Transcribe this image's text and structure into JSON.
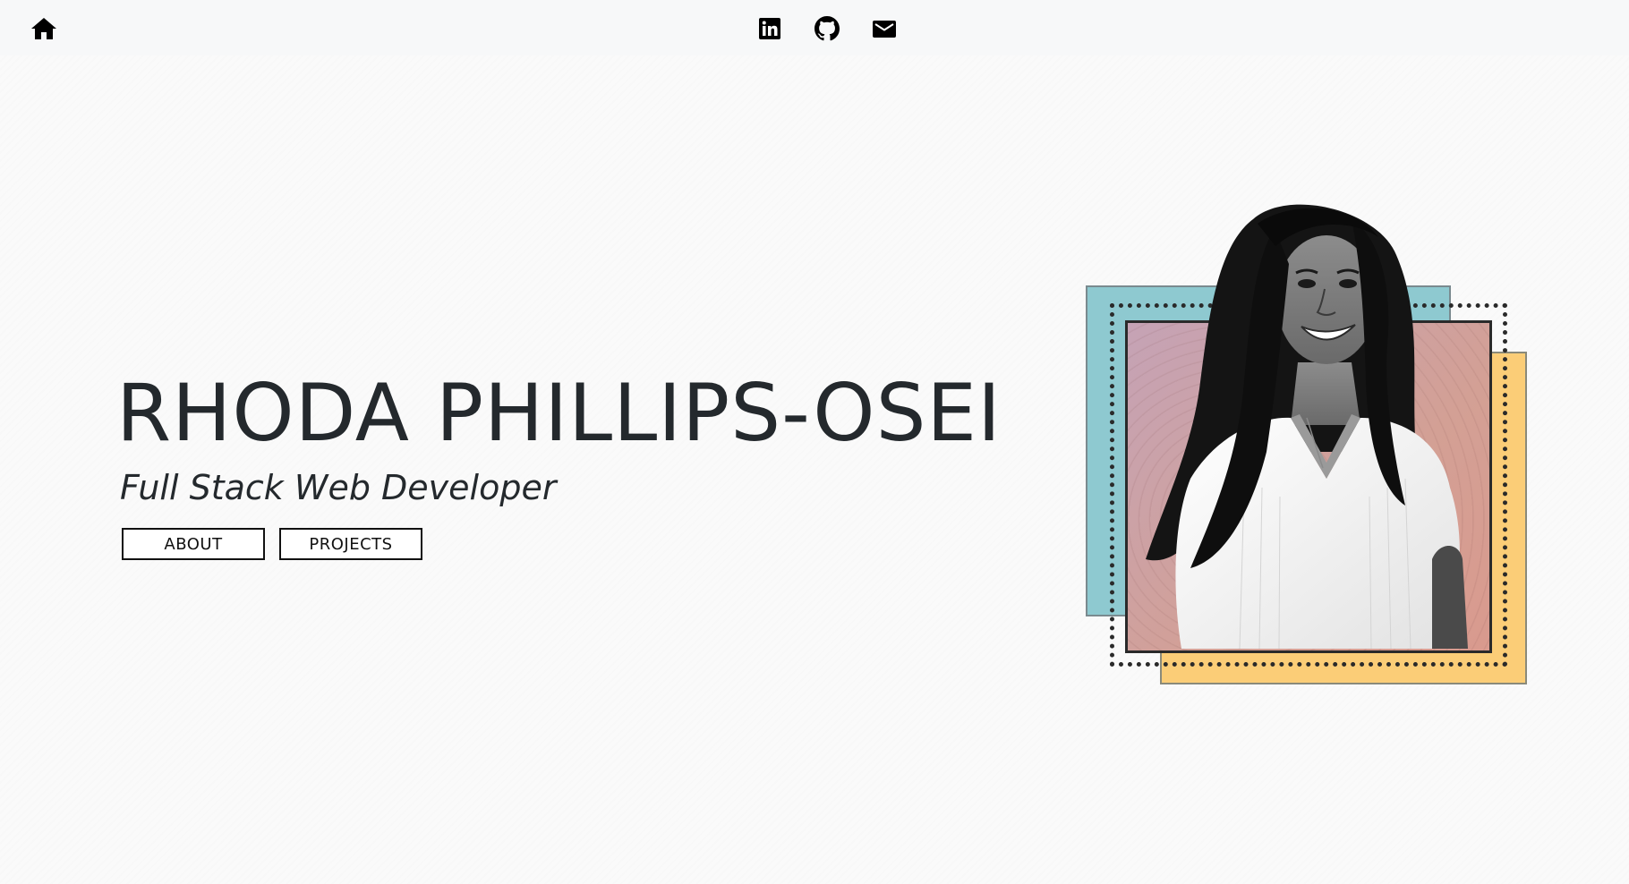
{
  "nav": {
    "home_icon": "home-icon",
    "social": [
      {
        "name": "linkedin",
        "icon": "linkedin-icon"
      },
      {
        "name": "github",
        "icon": "github-icon"
      },
      {
        "name": "email",
        "icon": "mail-icon"
      }
    ]
  },
  "hero": {
    "name": "RHODA PHILLIPS-OSEI",
    "title": "Full Stack Web Developer",
    "buttons": {
      "about": "ABOUT",
      "projects": "PROJECTS"
    }
  },
  "portrait": {
    "description_icon": "portrait-illustration",
    "colors": {
      "teal": "#8ec9d0",
      "yellow": "#fbcd77",
      "pink": "#d3a095",
      "outline": "#2a2a2a"
    }
  },
  "theme": {
    "background": "#fafafa",
    "text": "#24292d"
  }
}
